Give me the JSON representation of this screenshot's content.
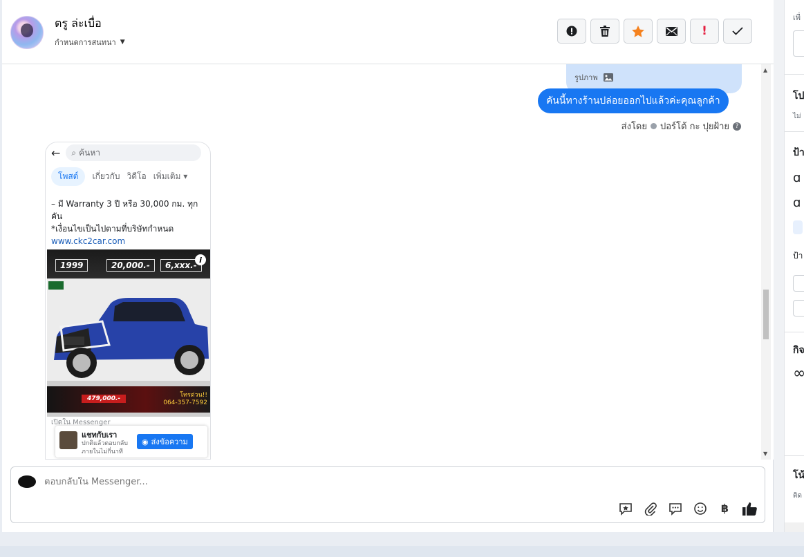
{
  "header": {
    "contact_name": "ตรู ล่ะเบื่อ",
    "assign_label": "กำหนดการสนทนา",
    "actions": [
      {
        "name": "mark-spam-button",
        "icon": "alert-circle-icon"
      },
      {
        "name": "delete-button",
        "icon": "trash-icon"
      },
      {
        "name": "star-button",
        "icon": "star-icon"
      },
      {
        "name": "mark-unread-button",
        "icon": "envelope-icon"
      },
      {
        "name": "follow-up-button",
        "icon": "exclamation-icon"
      },
      {
        "name": "mark-done-button",
        "icon": "check-icon"
      }
    ]
  },
  "thread": {
    "image_label": "รูปภาพ",
    "outgoing_message": "คันนี้ทางร้านปล่อยออกไปแล้วค่ะคุณลูกค้า",
    "sent_by_prefix": "ส่งโดย",
    "sent_by_name": "ปอร์โต้ กะ ปุยฝ้าย",
    "shared_screenshot": {
      "search_placeholder": "ค้นหา",
      "tabs": [
        "โพสต์",
        "เกี่ยวกับ",
        "วิดีโอ",
        "เพิ่มเติม"
      ],
      "line1": "– มี Warranty 3 ปี หรือ 30,000 กม. ทุกคัน",
      "line2": "*เงื่อนไขเป็นไปตามที่บริษัทกำหนด",
      "link": "www.ckc2car.com",
      "price_1": "1999",
      "price_2": "20,000.-",
      "price_3": "6,xxx.-",
      "price_tag": "479,000.-",
      "promo": "โทรด่วน!!",
      "promo_phone": "064-357-7592",
      "messenger_label": "เปิดใน Messenger",
      "chat_title": "แชทกับเรา",
      "chat_sub_1": "ปกติแล้วตอบกลับ",
      "chat_sub_2": "ภายในไม่กี่นาที",
      "send_button": "ส่งข้อความ"
    }
  },
  "composer": {
    "placeholder": "ตอบกลับใน Messenger...",
    "tools": [
      "saved-reply-icon",
      "attachment-icon",
      "chat-bubbles-icon",
      "emoji-icon",
      "baht-icon",
      "thumbs-up-icon"
    ]
  },
  "sidebar": {
    "frag_1": "เพื่",
    "frag_2": "โป",
    "frag_3": "ไม่",
    "frag_4": "ป้า",
    "frag_5": "ป้า",
    "frag_6": "กิจ",
    "frag_7": "โน้",
    "frag_8": "ติด"
  },
  "colors": {
    "brand_blue": "#1877f2",
    "image_bubble": "#cfe2fb",
    "star_orange": "#f5821f",
    "follow_up_red": "#e41e3f"
  }
}
